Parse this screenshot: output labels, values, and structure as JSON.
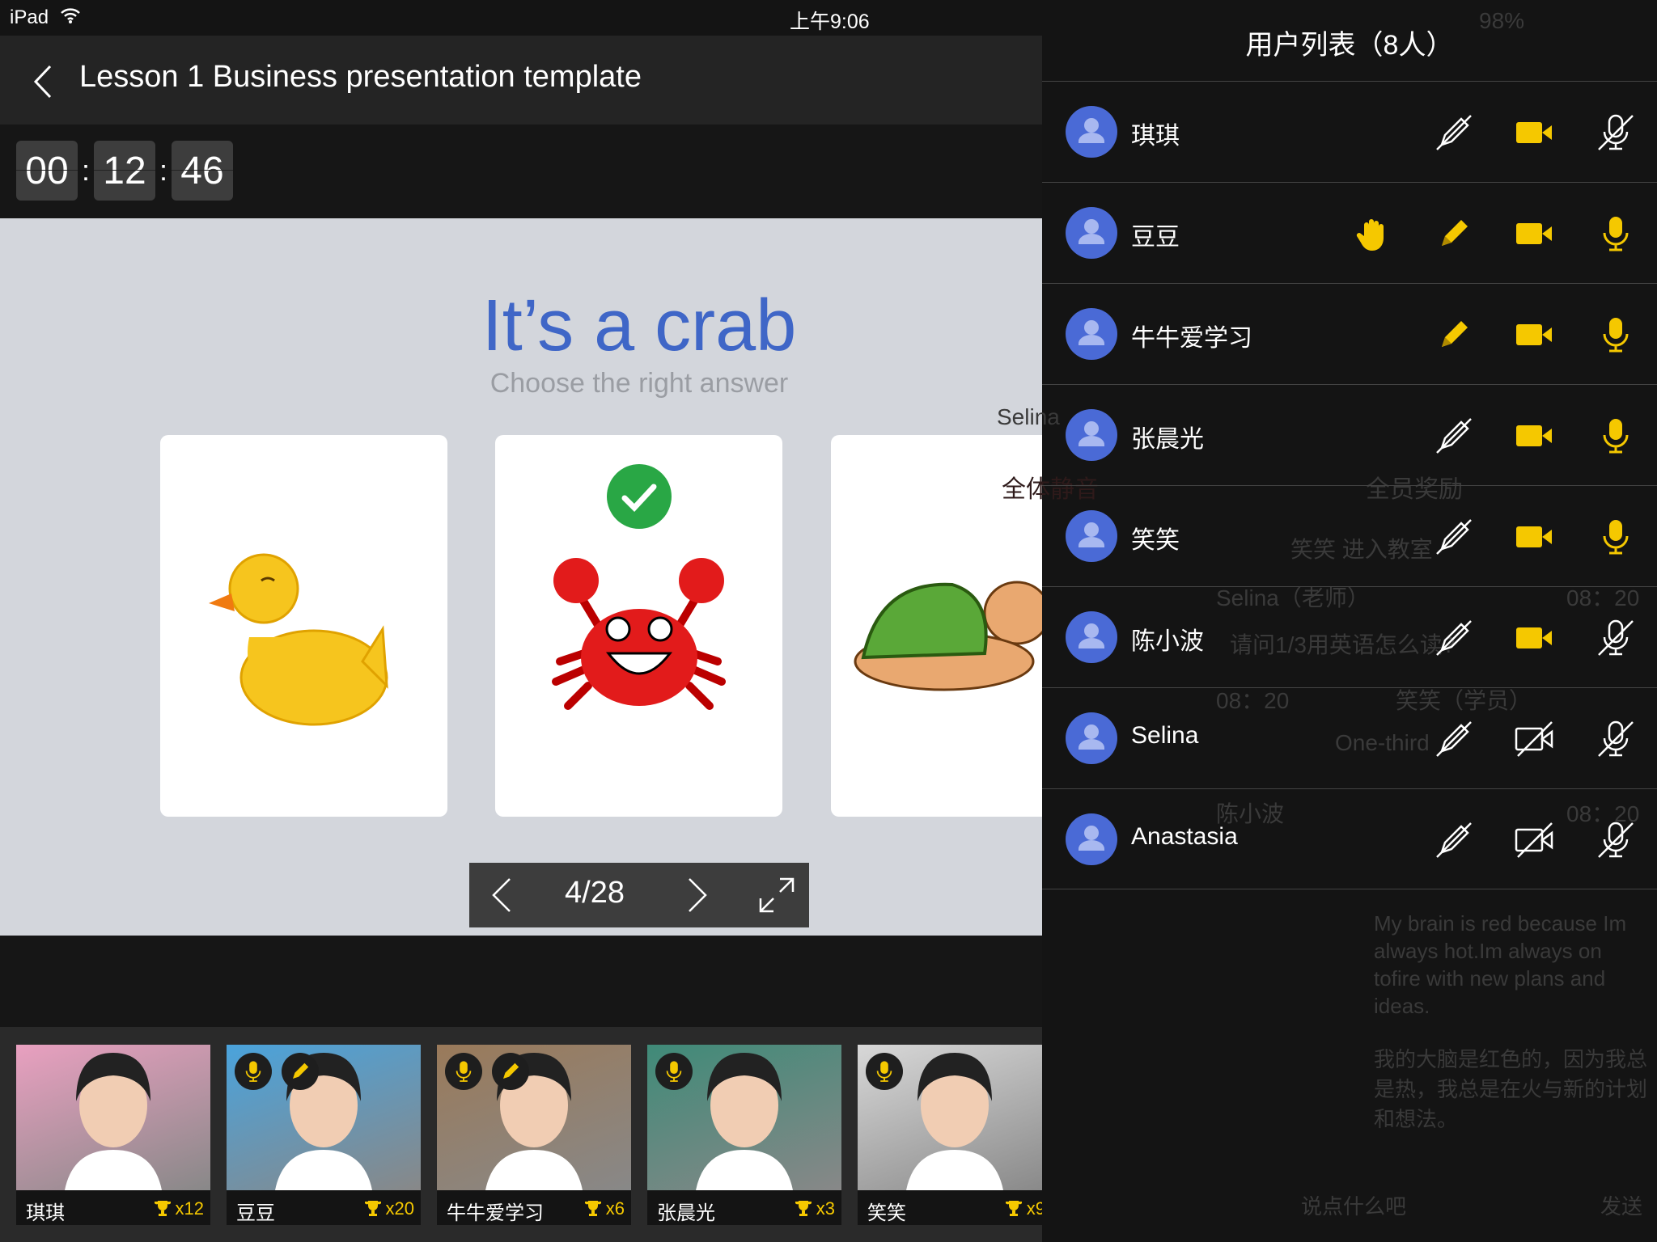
{
  "status_bar": {
    "carrier": "iPad",
    "time": "上午9:06",
    "battery": "98%"
  },
  "header": {
    "title": "Lesson 1 Business presentation template"
  },
  "timer": {
    "hours": "00",
    "minutes": "12",
    "seconds": "46",
    "separator": ":"
  },
  "slide": {
    "question": "It’s a crab",
    "instruction": "Choose the right answer",
    "options": [
      {
        "name": "duck",
        "correct": false
      },
      {
        "name": "crab",
        "correct": true
      },
      {
        "name": "turtle",
        "correct": false
      }
    ],
    "page": "4/28"
  },
  "students": [
    {
      "name": "琪琪",
      "score": "x12",
      "mic": false,
      "pen": false,
      "bg": "#e9a0c0"
    },
    {
      "name": "豆豆",
      "score": "x20",
      "mic": true,
      "pen": true,
      "bg": "#4aa3dc"
    },
    {
      "name": "牛牛爱学习",
      "score": "x6",
      "mic": true,
      "pen": true,
      "bg": "#9a7a5a"
    },
    {
      "name": "张晨光",
      "score": "x3",
      "mic": true,
      "pen": false,
      "bg": "#3f8a78"
    },
    {
      "name": "笑笑",
      "score": "x9",
      "mic": true,
      "pen": false,
      "bg": "#d8d8d8"
    }
  ],
  "user_panel": {
    "title": "用户列表（8人）",
    "users": [
      {
        "name": "琪琪",
        "hand": false,
        "pen": false,
        "camera": true,
        "mic": false
      },
      {
        "name": "豆豆",
        "hand": true,
        "pen": true,
        "camera": true,
        "mic": true
      },
      {
        "name": "牛牛爱学习",
        "hand": false,
        "pen": true,
        "camera": true,
        "mic": true
      },
      {
        "name": "张晨光",
        "hand": false,
        "pen": false,
        "camera": true,
        "mic": true
      },
      {
        "name": "笑笑",
        "hand": false,
        "pen": false,
        "camera": true,
        "mic": true
      },
      {
        "name": "陈小波",
        "hand": false,
        "pen": false,
        "camera": true,
        "mic": false
      },
      {
        "name": "Selina",
        "hand": false,
        "pen": false,
        "camera": false,
        "mic": false
      },
      {
        "name": "Anastasia",
        "hand": false,
        "pen": false,
        "camera": false,
        "mic": false
      }
    ]
  },
  "background_dimmed": {
    "teacher_name": "Selina",
    "mute_all": "全体静音",
    "reward_all": "全员奖励",
    "join_notice": "笑笑 进入教室",
    "chat": [
      {
        "sender": "Selina（老师）",
        "time": "08：20",
        "text": "请问1/3用英语怎么读?"
      },
      {
        "sender": "笑笑（学员）",
        "time": "08：20",
        "text": "One-third"
      },
      {
        "sender": "陈小波",
        "time": "08：20",
        "text": "My brain is red because Im always hot.Im always on tofire with new plans and ideas.",
        "translation": "我的大脑是红色的，因为我总是热，我总是在火与新的计划和想法。"
      }
    ],
    "thumb_name": "陈小波",
    "thumb_score": "x12",
    "chat_placeholder": "说点什么吧",
    "send": "发送"
  },
  "colors": {
    "accent_yellow": "#f5c800",
    "title_blue": "#3f66c7",
    "avatar_blue": "#4a6ad6",
    "correct_green": "#29a745"
  }
}
